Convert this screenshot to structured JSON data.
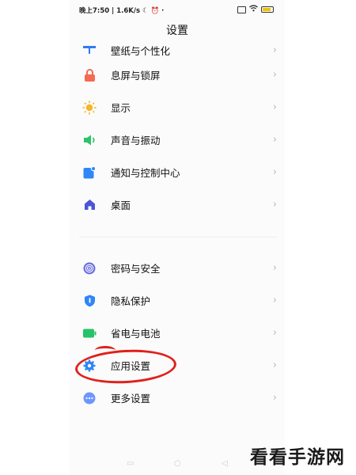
{
  "status_bar": {
    "time": "晚上7:50",
    "speed": "1.6K/s"
  },
  "header": {
    "title": "设置"
  },
  "settings": {
    "group1": [
      {
        "label": "壁纸与个性化",
        "icon": "wallpaper-icon",
        "color": "#2f7bf6"
      },
      {
        "label": "息屏与锁屏",
        "icon": "lock-icon",
        "color": "#f36b50"
      },
      {
        "label": "显示",
        "icon": "sun-icon",
        "color": "#f6b42a"
      },
      {
        "label": "声音与振动",
        "icon": "speaker-icon",
        "color": "#2fc36a"
      },
      {
        "label": "通知与控制中心",
        "icon": "notification-icon",
        "color": "#2f86f6"
      },
      {
        "label": "桌面",
        "icon": "home-icon",
        "color": "#4a55d8"
      }
    ],
    "group2": [
      {
        "label": "密码与安全",
        "icon": "fingerprint-icon",
        "color": "#6c6fe0"
      },
      {
        "label": "隐私保护",
        "icon": "shield-icon",
        "color": "#2f86f6"
      },
      {
        "label": "省电与电池",
        "icon": "battery-icon",
        "color": "#27c26a"
      },
      {
        "label": "应用设置",
        "icon": "gear-icon",
        "color": "#2f86f6"
      },
      {
        "label": "更多设置",
        "icon": "more-icon",
        "color": "#6e96ff"
      }
    ]
  },
  "watermark": "看看手游网"
}
